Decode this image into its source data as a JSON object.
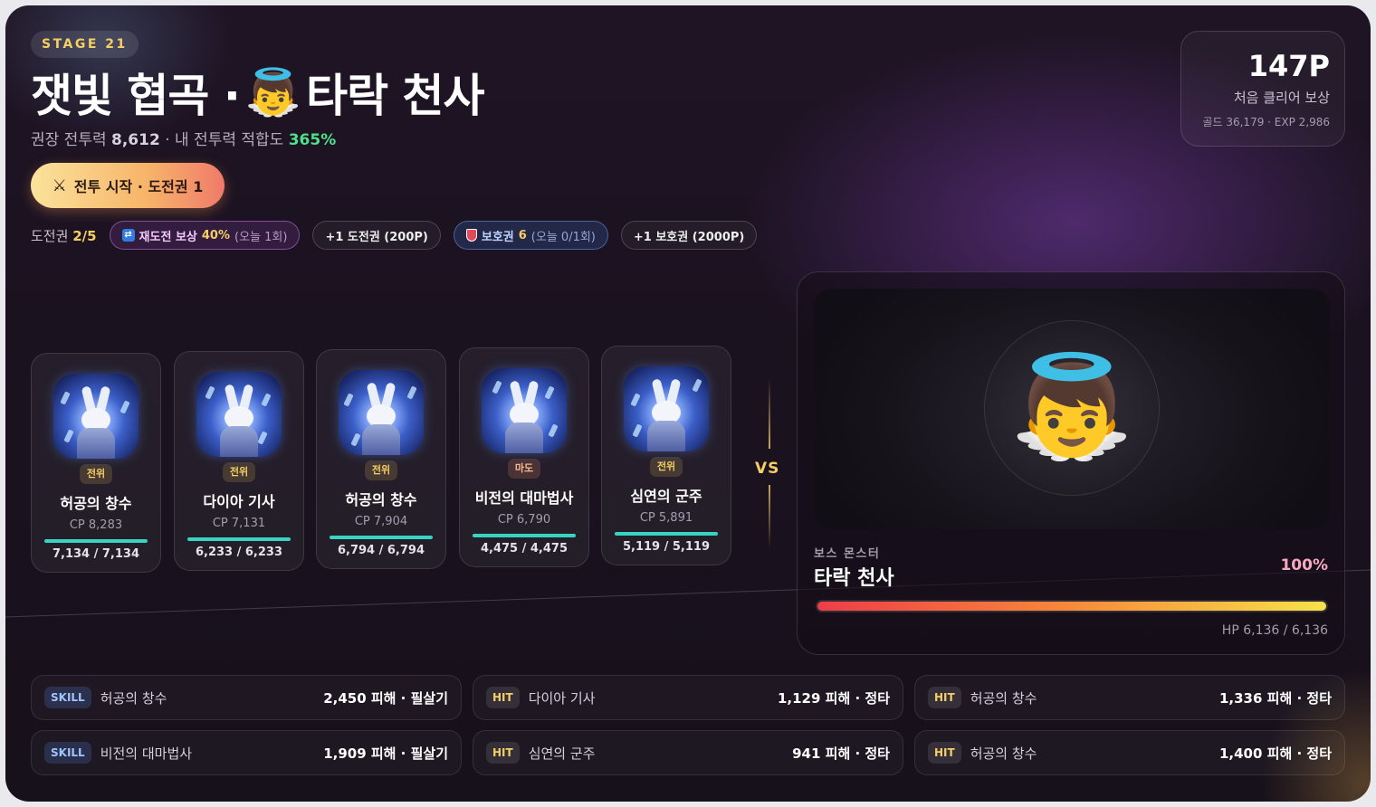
{
  "header": {
    "stage": "STAGE 21",
    "title_left": "잿빛 협곡 ·",
    "title_emoji": "👼",
    "title_right": "타락 천사",
    "rec_power_label": "권장 전투력",
    "rec_power": "8,612",
    "my_fit_label": "· 내 전투력 적합도",
    "my_fit": "365%"
  },
  "reward": {
    "points": "147P",
    "label": "처음 클리어 보상",
    "detail": "골드 36,179 · EXP 2,986"
  },
  "start_button": {
    "icon": "⚔",
    "label": "전투 시작 · 도전권 1"
  },
  "tickets": {
    "label": "도전권",
    "count": "2/5",
    "retry_icon": "🔁",
    "retry_label": "재도전 보상",
    "retry_value": "40%",
    "retry_note": "(오늘 1회)",
    "buy_ticket": "+1 도전권 (200P)",
    "guard_label": "보호권",
    "guard_value": "6",
    "guard_note": "(오늘 0/1회)",
    "buy_guard": "+1 보호권 (2000P)"
  },
  "party": [
    {
      "role": "전위",
      "name": "허공의 창수",
      "cp": "CP 8,283",
      "hp": "7,134 / 7,134",
      "hp_fraction": 1.0
    },
    {
      "role": "전위",
      "name": "다이아 기사",
      "cp": "CP 7,131",
      "hp": "6,233 / 6,233",
      "hp_fraction": 1.0
    },
    {
      "role": "전위",
      "name": "허공의 창수",
      "cp": "CP 7,904",
      "hp": "6,794 / 6,794",
      "hp_fraction": 1.0
    },
    {
      "role": "마도",
      "name": "비전의 대마법사",
      "cp": "CP 6,790",
      "hp": "4,475 / 4,475",
      "hp_fraction": 1.0
    },
    {
      "role": "전위",
      "name": "심연의 군주",
      "cp": "CP 5,891",
      "hp": "5,119 / 5,119",
      "hp_fraction": 1.0
    }
  ],
  "vs": "VS",
  "boss": {
    "emoji": "👼",
    "kicker": "보스 몬스터",
    "name": "타락 천사",
    "percent": "100%",
    "hp_fraction": 1.0,
    "hp": "HP 6,136 / 6,136"
  },
  "log": [
    {
      "tag": "SKILL",
      "who": "허공의 창수",
      "dmg": "2,450 피해 · 필살기"
    },
    {
      "tag": "HIT",
      "who": "다이아 기사",
      "dmg": "1,129 피해 · 정타"
    },
    {
      "tag": "HIT",
      "who": "허공의 창수",
      "dmg": "1,336 피해 · 정타"
    },
    {
      "tag": "SKILL",
      "who": "비전의 대마법사",
      "dmg": "1,909 피해 · 필살기"
    },
    {
      "tag": "HIT",
      "who": "심연의 군주",
      "dmg": "941 피해 · 정타"
    },
    {
      "tag": "HIT",
      "who": "허공의 창수",
      "dmg": "1,400 피해 · 정타"
    }
  ],
  "colors": {
    "accent_gold": "#f5cf66",
    "fit_green": "#4ee08a",
    "hp_teal": "#37d3c5",
    "boss_bar_start": "#ee3d48",
    "boss_bar_end": "#f6e24a"
  }
}
